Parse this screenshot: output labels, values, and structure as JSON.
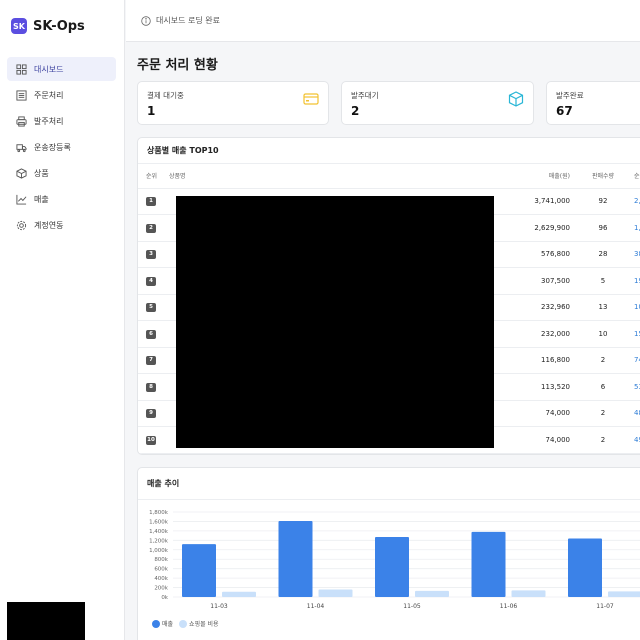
{
  "brand": {
    "logo": "SK",
    "name": "SK-Ops"
  },
  "sidebar": {
    "items": [
      {
        "label": "대시보드",
        "icon": "grid-icon",
        "active": true
      },
      {
        "label": "주문처리",
        "icon": "list-icon",
        "active": false
      },
      {
        "label": "발주처리",
        "icon": "printer-icon",
        "active": false
      },
      {
        "label": "운송장등록",
        "icon": "truck-icon",
        "active": false
      },
      {
        "label": "상품",
        "icon": "box-icon",
        "active": false
      },
      {
        "label": "매출",
        "icon": "chart-line-icon",
        "active": false
      },
      {
        "label": "계정연동",
        "icon": "gear-icon",
        "active": false
      }
    ]
  },
  "topbar": {
    "status": "대시보드 로딩 완료"
  },
  "page": {
    "title": "주문 처리 현황"
  },
  "stats": [
    {
      "label": "결제 대기중",
      "value": "1",
      "icon": "card-icon",
      "color": "#f2c230"
    },
    {
      "label": "발주대기",
      "value": "2",
      "icon": "cube-icon",
      "color": "#29b6d6"
    },
    {
      "label": "발주완료",
      "value": "67",
      "icon": "",
      "color": ""
    }
  ],
  "top10": {
    "title": "상품별 매출 TOP10",
    "columns": [
      "순위",
      "상품명",
      "매출(원)",
      "판매수량",
      "순익"
    ],
    "rows": [
      {
        "rank": "1",
        "sales": "3,741,000",
        "qty": "92",
        "profit": "2,3"
      },
      {
        "rank": "2",
        "sales": "2,629,900",
        "qty": "96",
        "profit": "1,7"
      },
      {
        "rank": "3",
        "sales": "576,800",
        "qty": "28",
        "profit": "38"
      },
      {
        "rank": "4",
        "sales": "307,500",
        "qty": "5",
        "profit": "19"
      },
      {
        "rank": "5",
        "sales": "232,960",
        "qty": "13",
        "profit": "10"
      },
      {
        "rank": "6",
        "sales": "232,000",
        "qty": "10",
        "profit": "15"
      },
      {
        "rank": "7",
        "sales": "116,800",
        "qty": "2",
        "profit": "74"
      },
      {
        "rank": "8",
        "sales": "113,520",
        "qty": "6",
        "profit": "53"
      },
      {
        "rank": "9",
        "sales": "74,000",
        "qty": "2",
        "profit": "48"
      },
      {
        "rank": "10",
        "sales": "74,000",
        "qty": "2",
        "profit": "49"
      }
    ]
  },
  "trend": {
    "title": "매출 추이",
    "legend": [
      "매출",
      "쇼핑몰 비용"
    ]
  },
  "chart_data": {
    "type": "bar",
    "categories": [
      "11-03",
      "11-04",
      "11-05",
      "11-06",
      "11-07"
    ],
    "series": [
      {
        "name": "매출",
        "values": [
          1120000,
          1610000,
          1270000,
          1380000,
          1240000
        ],
        "color": "#3b82e8"
      },
      {
        "name": "쇼핑몰 비용",
        "values": [
          110000,
          160000,
          130000,
          140000,
          120000
        ],
        "color": "#c9e0fa"
      }
    ],
    "yticks": [
      "0k",
      "200k",
      "400k",
      "600k",
      "800k",
      "1,000k",
      "1,200k",
      "1,400k",
      "1,600k",
      "1,800k"
    ],
    "ylim": [
      0,
      1800000
    ],
    "grid": true,
    "legend_position": "bottom-left"
  }
}
